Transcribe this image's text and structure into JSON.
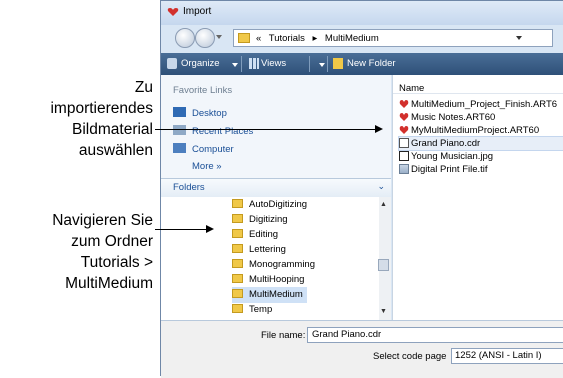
{
  "callouts": {
    "select_artwork": [
      "Zu",
      "importierendes",
      "Bildmaterial",
      "auswählen"
    ],
    "navigate_folder": [
      "Navigieren Sie",
      "zum Ordner",
      "Tutorials >",
      "MultiMedium"
    ]
  },
  "dialog": {
    "title": "Import",
    "breadcrumb": [
      "«",
      "Tutorials",
      "▸",
      "MultiMedium"
    ],
    "toolbar": {
      "organize": "Organize",
      "views": "Views",
      "new_folder": "New Folder"
    },
    "favorite_links": {
      "header": "Favorite Links",
      "items": [
        "Desktop",
        "Recent Places",
        "Computer"
      ],
      "more": "More »"
    },
    "folders": {
      "header": "Folders",
      "chevron": "⌄",
      "items": [
        "AutoDigitizing",
        "Digitizing",
        "Editing",
        "Lettering",
        "Monogramming",
        "MultiHooping",
        "MultiMedium",
        "Temp"
      ],
      "selected": "MultiMedium"
    },
    "files": {
      "column_header": "Name",
      "items": [
        "MultiMedium_Project_Finish.ART6",
        "Music Notes.ART60",
        "MyMultiMediumProject.ART60",
        "Grand Piano.cdr",
        "Young Musician.jpg",
        "Digital Print File.tif"
      ],
      "selected": "Grand Piano.cdr"
    },
    "file_name_label": "File name:",
    "file_name_value": "Grand Piano.cdr",
    "code_page_label": "Select code page",
    "code_page_value": "1252  (ANSI - Latin I)"
  }
}
